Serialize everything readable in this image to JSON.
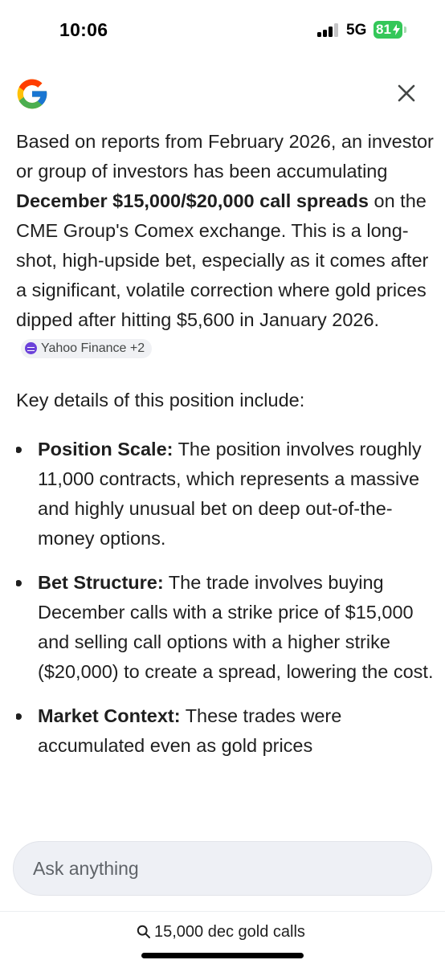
{
  "status_bar": {
    "time": "10:06",
    "network": "5G",
    "battery": "81"
  },
  "header": {
    "logo_icon": "google-g-icon",
    "close_icon": "close-icon"
  },
  "answer": {
    "para1": {
      "text_before": "Based on reports from February 2026, an investor or group of investors has been accumulating ",
      "bold": "December $15,000/$20,000 call spreads",
      "text_after": " on the CME Group's Comex exchange. This is a long-shot, high-upside bet, especially as it comes after a significant, volatile correction where gold prices dipped after hitting $5,600 in January 2026.",
      "source_chip": "Yahoo Finance +2"
    },
    "intro": "Key details of this position include:",
    "bullets": [
      {
        "title": "Position Scale:",
        "text": " The position involves roughly 11,000 contracts, which represents a massive and highly unusual bet on deep out-of-the-money options."
      },
      {
        "title": "Bet Structure:",
        "text": " The trade involves buying December calls with a strike price of $15,000 and selling call options with a higher strike ($20,000) to create a spread, lowering the cost."
      },
      {
        "title": "Market Context:",
        "text": " These trades were accumulated even as gold prices"
      }
    ]
  },
  "ask_bar": {
    "placeholder": "Ask anything"
  },
  "search_query": {
    "icon": "search-icon",
    "text": "15,000 dec gold calls"
  },
  "colors": {
    "battery_green": "#34c759",
    "chip_icon": "#6b41d9",
    "ask_bar_bg": "#eef0f5"
  }
}
